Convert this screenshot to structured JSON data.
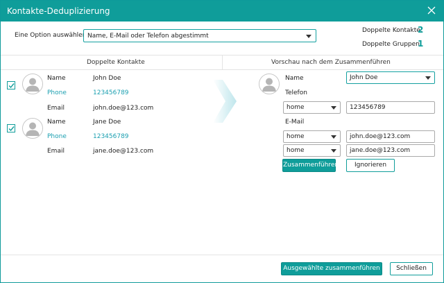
{
  "window": {
    "title": "Kontakte-Deduplizierung"
  },
  "options": {
    "label": "Eine Option auswählen:",
    "selected": "Name, E-Mail oder Telefon abgestimmt"
  },
  "stats": {
    "duplicate_contacts_label": "Doppelte Kontakte:",
    "duplicate_contacts_value": "2",
    "duplicate_groups_label": "Doppelte Gruppen:",
    "duplicate_groups_value": "1"
  },
  "columns": {
    "left": "Doppelte Kontakte",
    "right": "Vorschau nach dem Zusammenführen"
  },
  "contacts": [
    {
      "checked": true,
      "name_label": "Name",
      "name": "John Doe",
      "phone_label": "Phone",
      "phone": "123456789",
      "email_label": "Email",
      "email": "john.doe@123.com"
    },
    {
      "checked": true,
      "name_label": "Name",
      "name": "Jane Doe",
      "phone_label": "Phone",
      "phone": "123456789",
      "email_label": "Email",
      "email": "jane.doe@123.com"
    }
  ],
  "preview": {
    "name_label": "Name",
    "name_value": "John Doe",
    "phone_section": "Telefon",
    "phones": [
      {
        "type": "home",
        "value": "123456789"
      }
    ],
    "email_section": "E-Mail",
    "emails": [
      {
        "type": "home",
        "value": "john.doe@123.com"
      },
      {
        "type": "home",
        "value": "jane.doe@123.com"
      }
    ],
    "merge_button": "Zusammenführen",
    "ignore_button": "Ignorieren"
  },
  "footer": {
    "merge_selected": "Ausgewählte zusammenführen",
    "close": "Schließen"
  },
  "colors": {
    "accent": "#0f9d9a",
    "link": "#1a9fb0"
  }
}
